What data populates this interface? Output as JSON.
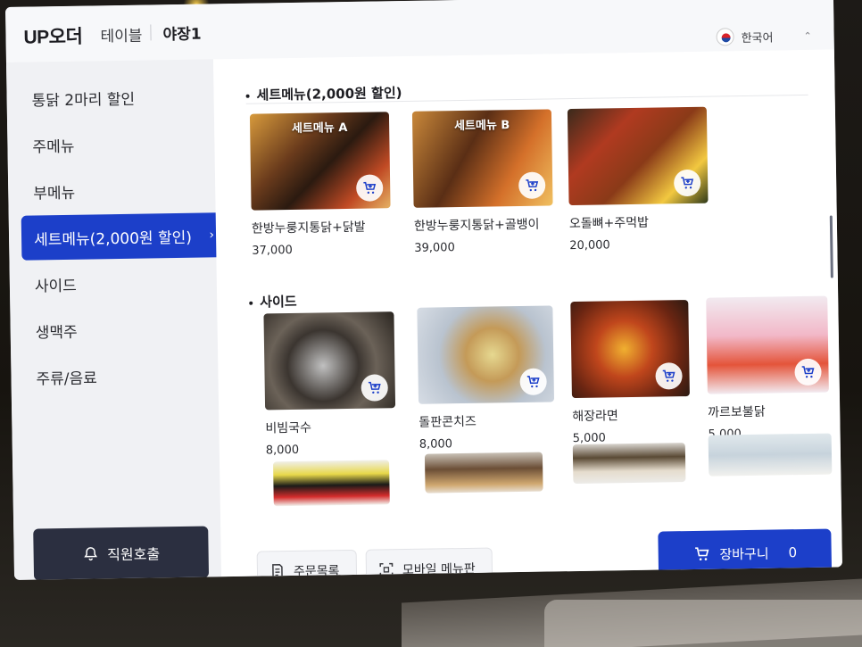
{
  "header": {
    "logo": "UP오더",
    "table_label": "테이블",
    "table_name": "야장1",
    "language": "한국어"
  },
  "sidebar": {
    "items": [
      {
        "label": "통닭 2마리 할인"
      },
      {
        "label": "주메뉴"
      },
      {
        "label": "부메뉴"
      },
      {
        "label": "세트메뉴(2,000원 할인)",
        "active": true
      },
      {
        "label": "사이드"
      },
      {
        "label": "생맥주"
      },
      {
        "label": "주류/음료"
      }
    ],
    "call_staff": "직원호출"
  },
  "sections": [
    {
      "title": "세트메뉴(2,000원 할인)",
      "items": [
        {
          "name": "한방누룽지통닭+닭발",
          "price": "37,000",
          "thumb_label": "세트메뉴 A",
          "icon": "cart-add-icon"
        },
        {
          "name": "한방누룽지통닭+골뱅이",
          "price": "39,000",
          "thumb_label": "세트메뉴 B",
          "icon": "cart-add-icon"
        },
        {
          "name": "오돌뼈+주먹밥",
          "price": "20,000",
          "thumb_label": "",
          "icon": "cart-add-icon"
        }
      ]
    },
    {
      "title": "사이드",
      "items": [
        {
          "name": "비빔국수",
          "price": "8,000",
          "icon": "cart-add-icon"
        },
        {
          "name": "돌판콘치즈",
          "price": "8,000",
          "icon": "cart-add-icon"
        },
        {
          "name": "해장라면",
          "price": "5,000",
          "icon": "cart-add-icon"
        },
        {
          "name": "까르보불닭",
          "price": "5,000",
          "icon": "cart-add-icon"
        }
      ]
    }
  ],
  "footer": {
    "order_list": "주문목록",
    "mobile_menu": "모바일 메뉴판",
    "cart_label": "장바구니",
    "cart_count": "0"
  },
  "colors": {
    "accent": "#1c3fc9",
    "call_button": "#2b2f40",
    "sidebar_bg": "#f0f1f4",
    "content_bg": "#ffffff"
  }
}
